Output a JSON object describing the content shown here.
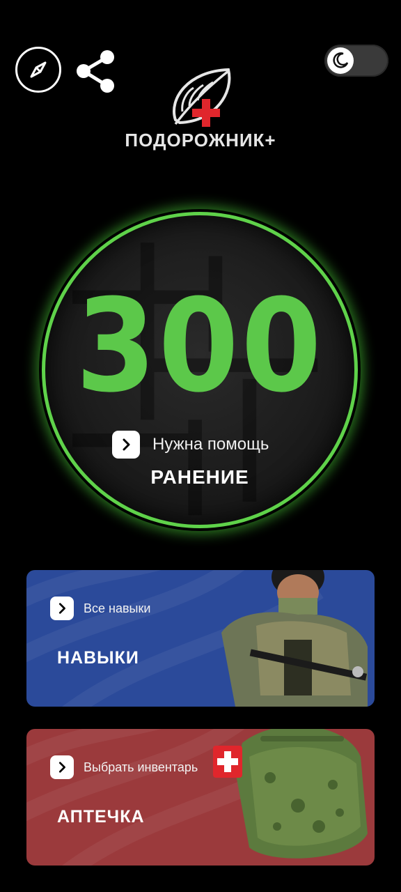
{
  "header": {
    "brand": "ПОДОРОЖНИК+",
    "icons": {
      "compass": "compass-icon",
      "share": "share-icon",
      "theme": "moon-icon"
    }
  },
  "sos": {
    "number": "300",
    "action_label": "Нужна помощь",
    "title": "РАНЕНИЕ"
  },
  "cards": {
    "skills": {
      "action_label": "Все навыки",
      "title": "НАВЫКИ"
    },
    "kit": {
      "action_label": "Выбрать инвентарь",
      "title": "АПТЕЧКА"
    }
  },
  "colors": {
    "background": "#000000",
    "accent_green": "#5cc84a",
    "skills_card": "#2b4a9a",
    "kit_card": "#9b3a3c",
    "red_cross": "#e0262c"
  }
}
